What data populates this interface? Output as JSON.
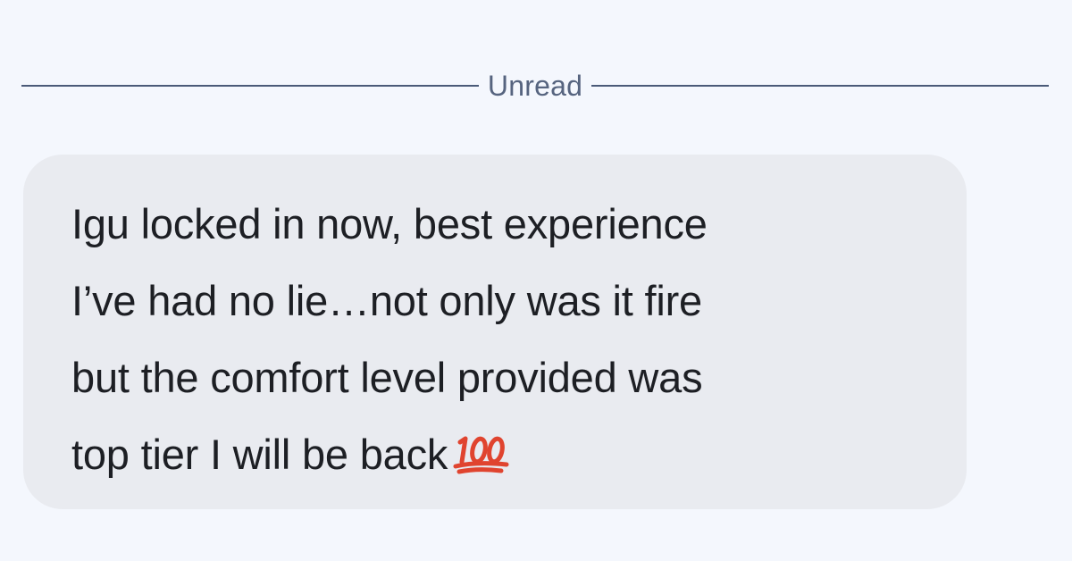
{
  "divider": {
    "label": "Unread",
    "line_color": "#4a5a78",
    "label_color": "#56647f"
  },
  "message": {
    "lines": [
      "Igu locked in now, best experience",
      "I’ve had no lie…not only was it fire",
      "but the comfort level provided was",
      "top tier I will be back"
    ],
    "emoji": "💯",
    "emoji_icon": "hundred-points-icon",
    "bubble_color": "#e9ebf0",
    "text_color": "#1d1f24",
    "emoji_color": "#e0442f"
  },
  "background_color": "#f4f7fd"
}
